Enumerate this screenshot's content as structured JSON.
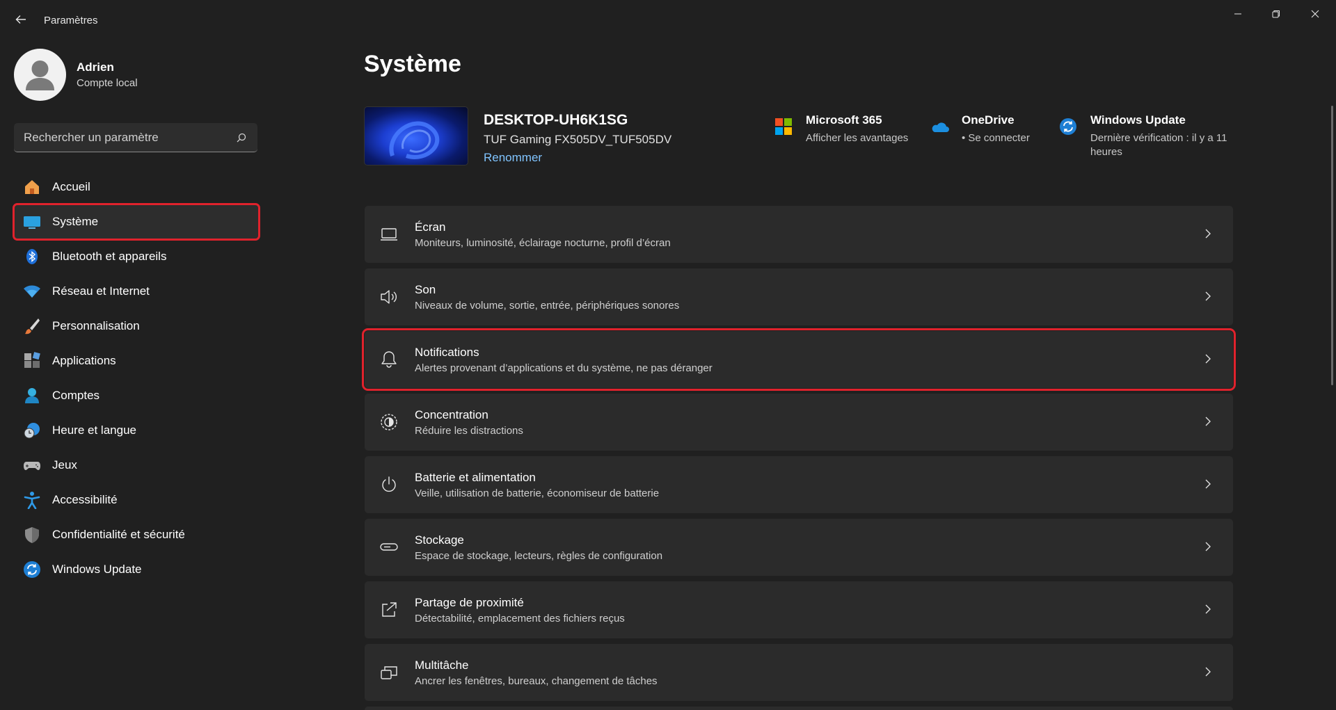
{
  "window": {
    "title": "Paramètres"
  },
  "profile": {
    "name": "Adrien",
    "account_type": "Compte local"
  },
  "search": {
    "placeholder": "Rechercher un paramètre"
  },
  "sidebar": {
    "items": [
      {
        "label": "Accueil",
        "icon": "home-icon"
      },
      {
        "label": "Système",
        "icon": "monitor-icon",
        "active": true
      },
      {
        "label": "Bluetooth et appareils",
        "icon": "bluetooth-icon"
      },
      {
        "label": "Réseau et Internet",
        "icon": "wifi-icon"
      },
      {
        "label": "Personnalisation",
        "icon": "brush-icon"
      },
      {
        "label": "Applications",
        "icon": "apps-icon"
      },
      {
        "label": "Comptes",
        "icon": "person-icon"
      },
      {
        "label": "Heure et langue",
        "icon": "globe-clock-icon"
      },
      {
        "label": "Jeux",
        "icon": "gamepad-icon"
      },
      {
        "label": "Accessibilité",
        "icon": "accessibility-icon"
      },
      {
        "label": "Confidentialité et sécurité",
        "icon": "shield-icon"
      },
      {
        "label": "Windows Update",
        "icon": "update-icon"
      }
    ]
  },
  "main": {
    "title": "Système",
    "device": {
      "name": "DESKTOP-UH6K1SG",
      "model": "TUF Gaming FX505DV_TUF505DV",
      "rename_label": "Renommer"
    },
    "quick_links": [
      {
        "title": "Microsoft 365",
        "subtitle": "Afficher les avantages",
        "icon": "microsoft-logo-icon"
      },
      {
        "title": "OneDrive",
        "subtitle": "• Se connecter",
        "icon": "onedrive-cloud-icon"
      },
      {
        "title": "Windows Update",
        "subtitle": "Dernière vérification : il y a 11 heures",
        "icon": "update-icon"
      }
    ],
    "cards": [
      {
        "title": "Écran",
        "subtitle": "Moniteurs, luminosité, éclairage nocturne, profil d’écran",
        "icon": "laptop-icon"
      },
      {
        "title": "Son",
        "subtitle": "Niveaux de volume, sortie, entrée, périphériques sonores",
        "icon": "speaker-icon"
      },
      {
        "title": "Notifications",
        "subtitle": "Alertes provenant d’applications et du système, ne pas déranger",
        "icon": "bell-icon",
        "highlighted": true
      },
      {
        "title": "Concentration",
        "subtitle": "Réduire les distractions",
        "icon": "focus-icon"
      },
      {
        "title": "Batterie et alimentation",
        "subtitle": "Veille, utilisation de batterie, économiseur de batterie",
        "icon": "power-icon"
      },
      {
        "title": "Stockage",
        "subtitle": "Espace de stockage, lecteurs, règles de configuration",
        "icon": "storage-icon"
      },
      {
        "title": "Partage de proximité",
        "subtitle": "Détectabilité, emplacement des fichiers reçus",
        "icon": "share-icon"
      },
      {
        "title": "Multitâche",
        "subtitle": "Ancrer les fenêtres, bureaux, changement de tâches",
        "icon": "multitask-icon"
      }
    ]
  },
  "colors": {
    "background": "#202020",
    "card": "#2b2b2b",
    "highlight_border": "#e0222c",
    "link": "#80c4ff"
  }
}
